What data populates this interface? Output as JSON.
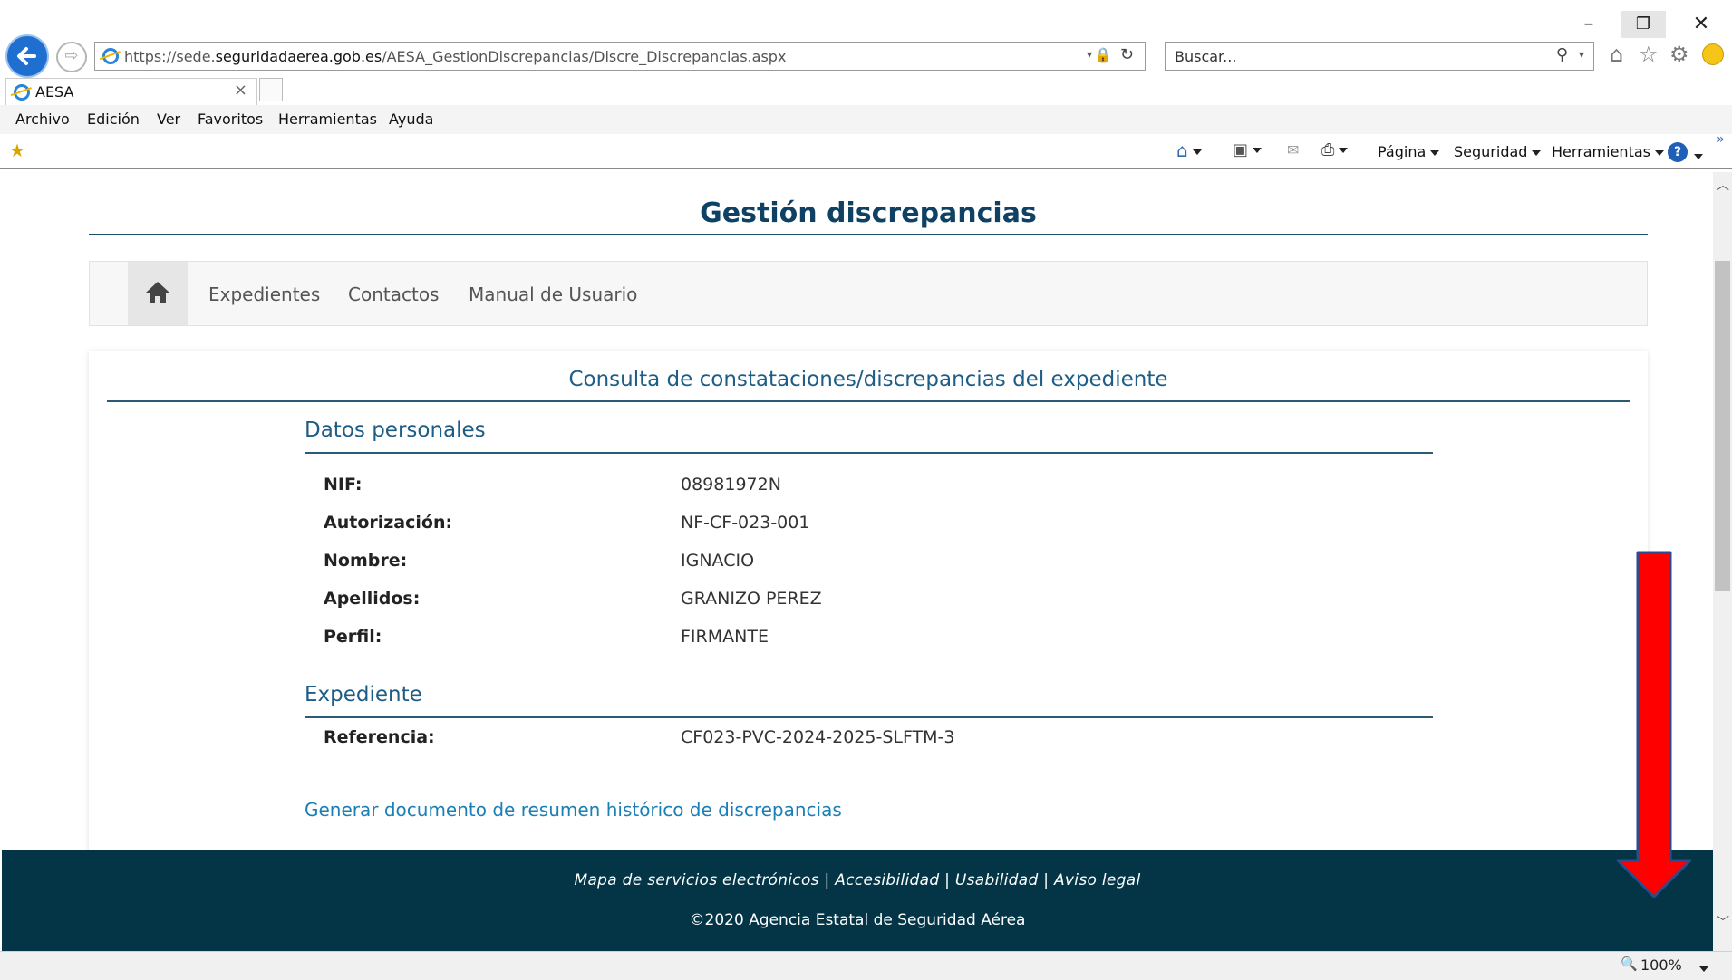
{
  "browser": {
    "address": {
      "prefix": "https://sede.",
      "domain": "seguridadaerea.gob.es",
      "path": "/AESA_GestionDiscrepancias/Discre_Discrepancias.aspx"
    },
    "search_placeholder": "Buscar...",
    "tab_title": "AESA",
    "menu": [
      "Archivo",
      "Edición",
      "Ver",
      "Favoritos",
      "Herramientas",
      "Ayuda"
    ],
    "commands": {
      "page": "Página",
      "security": "Seguridad",
      "tools": "Herramientas"
    },
    "zoom": "100%",
    "accent": "#1e6fd0"
  },
  "page": {
    "title": "Gestión discrepancias",
    "nav": [
      "Expedientes",
      "Contactos",
      "Manual de Usuario"
    ],
    "panel_title": "Consulta de constataciones/discrepancias del expediente",
    "personal": {
      "heading": "Datos personales",
      "rows": [
        {
          "label": "NIF:",
          "value": "08981972N"
        },
        {
          "label": "Autorización:",
          "value": "NF-CF-023-001"
        },
        {
          "label": "Nombre:",
          "value": "IGNACIO"
        },
        {
          "label": "Apellidos:",
          "value": "GRANIZO PEREZ"
        },
        {
          "label": "Perfil:",
          "value": "FIRMANTE"
        }
      ]
    },
    "expediente": {
      "heading": "Expediente",
      "rows": [
        {
          "label": "Referencia:",
          "value": "CF023-PVC-2024-2025-SLFTM-3"
        }
      ]
    },
    "generate_link": "Generar documento de resumen histórico de discrepancias",
    "footer": {
      "links": "Mapa de servicios electrónicos | Accesibilidad | Usabilidad | Aviso legal",
      "copyright": "©2020 Agencia Estatal de Seguridad Aérea"
    },
    "colors": {
      "heading": "#0e4163",
      "section": "#1e5d86",
      "footer_bg": "#033547",
      "link": "#1a7fb5",
      "arrow": "#ff0000"
    }
  }
}
